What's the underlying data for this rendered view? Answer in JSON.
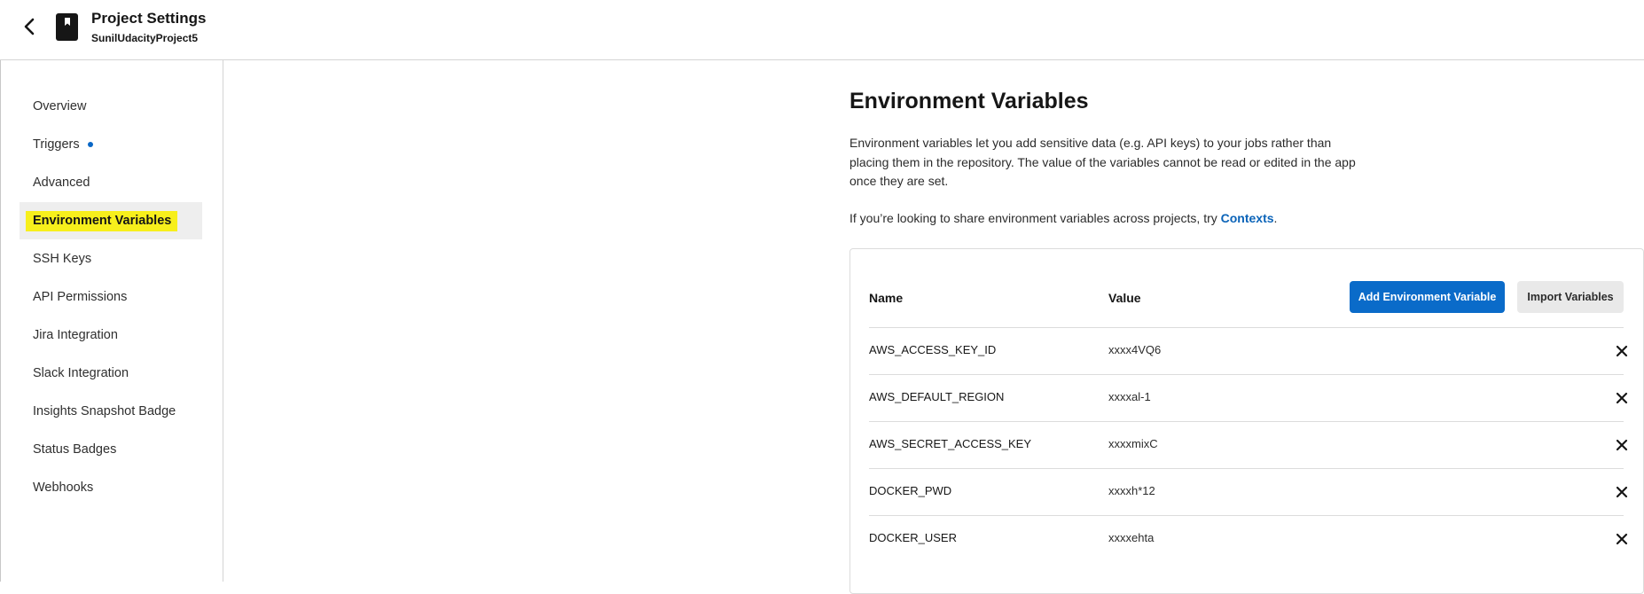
{
  "header": {
    "title": "Project Settings",
    "subtitle": "SunilUdacityProject5",
    "back_icon": "chevron-left-icon",
    "project_icon": "bookmark-book-icon"
  },
  "sidebar": {
    "items": [
      {
        "label": "Overview"
      },
      {
        "label": "Triggers",
        "dot": true
      },
      {
        "label": "Advanced"
      },
      {
        "label": "Environment Variables",
        "active": true
      },
      {
        "label": "SSH Keys"
      },
      {
        "label": "API Permissions"
      },
      {
        "label": "Jira Integration"
      },
      {
        "label": "Slack Integration"
      },
      {
        "label": "Insights Snapshot Badge"
      },
      {
        "label": "Status Badges"
      },
      {
        "label": "Webhooks"
      }
    ]
  },
  "main": {
    "title": "Environment Variables",
    "description": "Environment variables let you add sensitive data (e.g. API keys) to your jobs rather than placing them in the repository. The value of the variables cannot be read or edited in the app once they are set.",
    "share_text": "If you’re looking to share environment variables across projects, try ",
    "share_link": "Contexts",
    "share_suffix": "."
  },
  "table": {
    "col_name": "Name",
    "col_value": "Value",
    "add_button": "Add Environment Variable",
    "import_button": "Import Variables",
    "delete_icon": "close-icon",
    "rows": [
      {
        "name": "AWS_ACCESS_KEY_ID",
        "value": "xxxx4VQ6"
      },
      {
        "name": "AWS_DEFAULT_REGION",
        "value": "xxxxal-1"
      },
      {
        "name": "AWS_SECRET_ACCESS_KEY",
        "value": "xxxxmixC"
      },
      {
        "name": "DOCKER_PWD",
        "value": "xxxxh*12"
      },
      {
        "name": "DOCKER_USER",
        "value": "xxxxehta"
      }
    ]
  },
  "colors": {
    "accent": "#0a6bc9",
    "link": "#0a63b8",
    "highlight": "#f7ef1c"
  }
}
